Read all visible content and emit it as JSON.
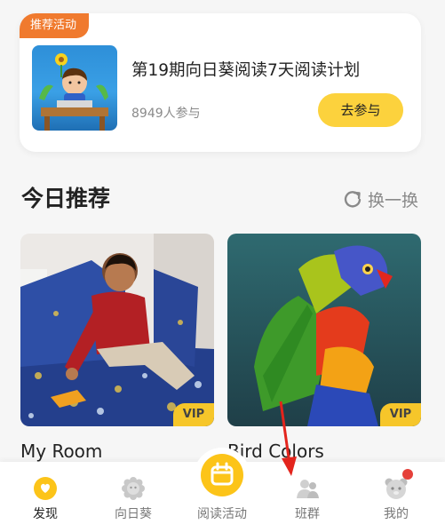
{
  "activity": {
    "tag": "推荐活动",
    "title": "第19期向日葵阅读7天阅读计划",
    "participants": "8949人参与",
    "join_label": "去参与"
  },
  "recommend": {
    "title": "今日推荐",
    "refresh_label": "换一换"
  },
  "books": [
    {
      "title": "My Room",
      "badge": "VIP"
    },
    {
      "title": "Bird Colors",
      "badge": "VIP"
    }
  ],
  "nav": {
    "items": [
      {
        "label": "发现",
        "icon": "discover-icon",
        "active": true
      },
      {
        "label": "向日葵",
        "icon": "sunflower-icon",
        "active": false
      },
      {
        "label": "阅读活动",
        "icon": "reading-activity-icon",
        "active": false
      },
      {
        "label": "班群",
        "icon": "class-group-icon",
        "active": false
      },
      {
        "label": "我的",
        "icon": "profile-icon",
        "active": false
      }
    ]
  },
  "colors": {
    "accent_yellow": "#fcd23d",
    "tag_orange": "#f07a2e",
    "badge_red": "#e5403a",
    "arrow_red": "#e3241c"
  }
}
